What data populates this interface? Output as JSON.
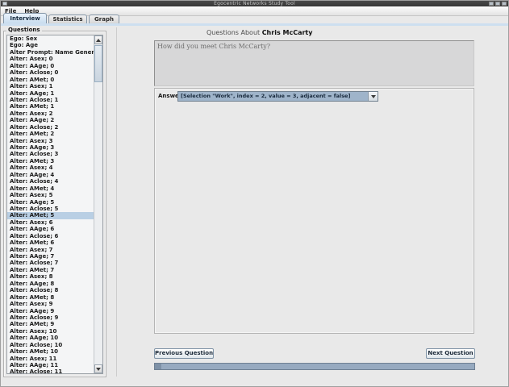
{
  "window": {
    "title": "Egocentric Networks Study Tool"
  },
  "menu": {
    "items": [
      "File",
      "Help"
    ]
  },
  "tabs": {
    "items": [
      "Interview",
      "Statistics",
      "Graph"
    ],
    "selected": "Interview"
  },
  "sidebar": {
    "title": "Questions",
    "selected_index": 26,
    "items": [
      "Ego: Sex",
      "Ego: Age",
      "Alter Prompt: Name Generator",
      "Alter: Asex; 0",
      "Alter: AAge; 0",
      "Alter: Aclose; 0",
      "Alter: AMet; 0",
      "Alter: Asex; 1",
      "Alter: AAge; 1",
      "Alter: Aclose; 1",
      "Alter: AMet; 1",
      "Alter: Asex; 2",
      "Alter: AAge; 2",
      "Alter: Aclose; 2",
      "Alter: AMet; 2",
      "Alter: Asex; 3",
      "Alter: AAge; 3",
      "Alter: Aclose; 3",
      "Alter: AMet; 3",
      "Alter: Asex; 4",
      "Alter: AAge; 4",
      "Alter: Aclose; 4",
      "Alter: AMet; 4",
      "Alter: Asex; 5",
      "Alter: AAge; 5",
      "Alter: Aclose; 5",
      "Alter: AMet; 5",
      "Alter: Asex; 6",
      "Alter: AAge; 6",
      "Alter: Aclose; 6",
      "Alter: AMet; 6",
      "Alter: Asex; 7",
      "Alter: AAge; 7",
      "Alter: Aclose; 7",
      "Alter: AMet; 7",
      "Alter: Asex; 8",
      "Alter: AAge; 8",
      "Alter: Aclose; 8",
      "Alter: AMet; 8",
      "Alter: Asex; 9",
      "Alter: AAge; 9",
      "Alter: Aclose; 9",
      "Alter: AMet; 9",
      "Alter: Asex; 10",
      "Alter: AAge; 10",
      "Alter: Aclose; 10",
      "Alter: AMet; 10",
      "Alter: Asex; 11",
      "Alter: AAge; 11",
      "Alter: Aclose; 11"
    ]
  },
  "main": {
    "header_prefix": "Questions About ",
    "header_name": "Chris McCarty",
    "question_text": "How did you meet Chris McCarty?",
    "answer_label": "Answer:",
    "answer_value": "[Selection \"Work\", index = 2, value = 3, adjacent = false]",
    "prev_button": "Previous Question",
    "next_button": "Next Question",
    "progress_fraction": 0.02
  },
  "colors": {
    "selection": "#b9cfe4",
    "tab_selected": "#c8dcee",
    "combo_selection": "#9fb4ca",
    "progress_bar": "#97aac0",
    "panel_background": "#e9e9e9",
    "titlebar": "#3e3e3e"
  }
}
